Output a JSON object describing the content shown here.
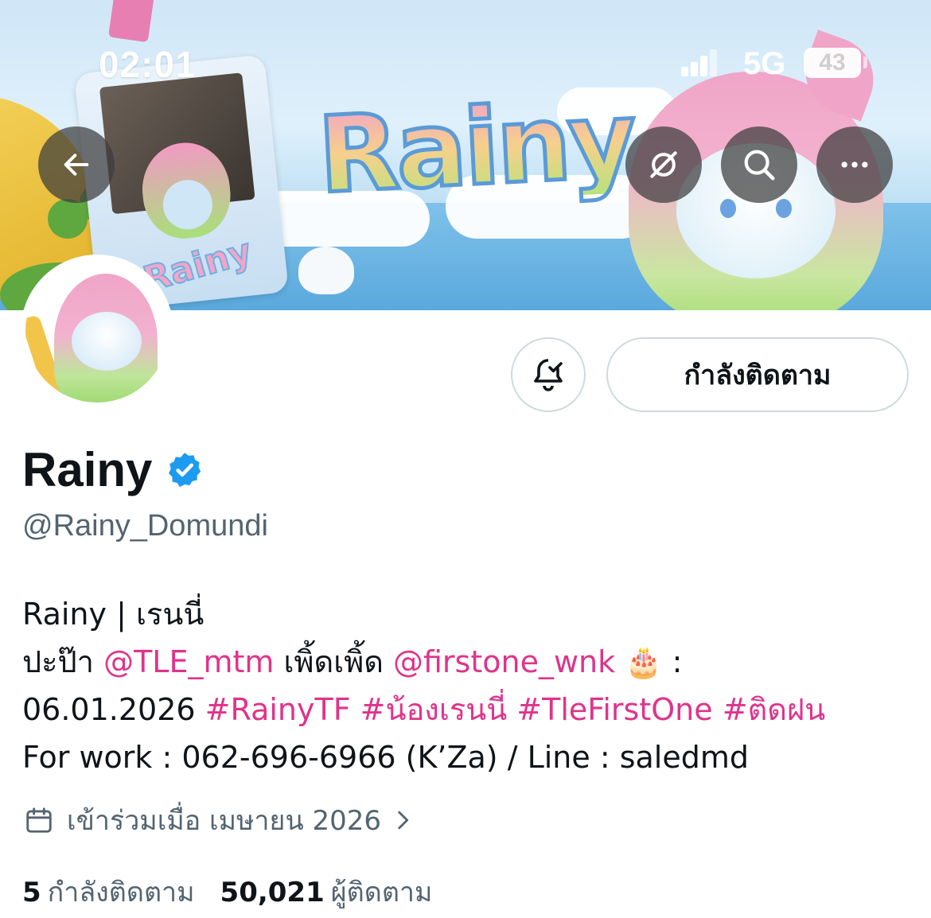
{
  "status_bar": {
    "time": "02:01",
    "network": "5G",
    "battery": "43"
  },
  "banner": {
    "logo_text": "Rainy",
    "card_text": "Rainy",
    "icons": [
      "back-arrow-icon",
      "disconnect-icon",
      "search-icon",
      "more-icon"
    ]
  },
  "profile": {
    "follow_button": "กำลังติดตาม",
    "name": "Rainy",
    "handle": "@Rainy_Domundi",
    "verified": true,
    "bio": {
      "line1": "Rainy | เรนนี่",
      "line2_prefix": "ปะป๊า ",
      "mention1": "@TLE_mtm",
      "line2_mid": " เพิ้ดเพิ้ด ",
      "mention2": "@firstone_wnk",
      "emoji": " 🎂 :",
      "date": "06.01.2026 ",
      "hashtag1": "#RainyTF",
      "hashtag2": "#น้องเรนนี่",
      "hashtag3": "#TleFirstOne",
      "hashtag4": "#ติดฝน",
      "line4": "For work : 062-696-6966 (K’Za) / Line : saledmd"
    },
    "joined": "เข้าร่วมเมื่อ เมษายน 2026"
  },
  "stats": {
    "following_count": "5",
    "following_label": "กำลังติดตาม",
    "followers_count": "50,021",
    "followers_label": "ผู้ติดตาม"
  },
  "colors": {
    "accent_pink": "#e0338b",
    "verified_blue": "#1d9bf0",
    "secondary_text": "#536471"
  }
}
